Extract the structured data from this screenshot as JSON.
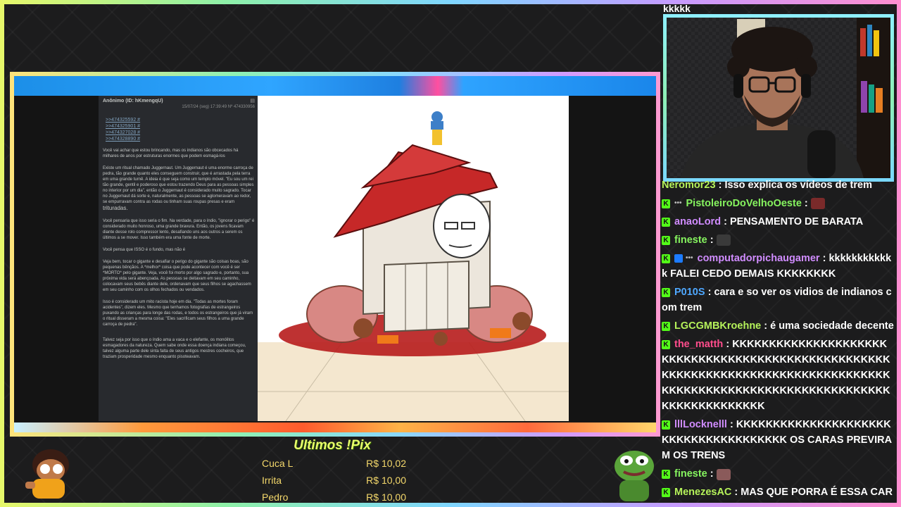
{
  "post": {
    "author": "Anônimo (ID: hKmengqU)",
    "datetime": "15/07/24 (seg) 17:39:49 Nº 474330956",
    "links": [
      ">>474325592 #",
      ">>474325901 #",
      ">>474327028 #",
      ">>474328890 #"
    ],
    "paragraphs": [
      "Você vai achar que estou brincando, mas os indianos são obcecados há milhares de anos por estruturas enormes que podem esmagá-los",
      "Existe um ritual chamado Juggernaut. Um Juggernaut é uma enorme carroça de pedra, tão grande quanto eles conseguem construir, que é arrastada pela terra em uma grande turnê. A ideia é que seja como um templo móvel. \"Eu sou um rei tão grande, gentil e poderoso que estou trazendo Deus para as pessoas simples no interior por um dia\", então o Juggernaut é considerado muito sagrado. Tocar no Juggernaut dá sorte e, naturalmente, as pessoas se aglomeravam ao redor, se empurravam contra as rodas ou tinham suas roupas presas e eram",
      "Você pensaria que isso seria o fim. Na verdade, para o índio, \"ignorar o perigo\" é considerado muito honroso, uma grande bravura. Então, os jovens ficavam diante desse rolo compressor lento, desafiando uns aos outros a serem os últimos a se mover. Isso também era uma fonte de morte.",
      "Você pensa que ISSO é o fundo, mas não é",
      "Veja bem, tocar o gigante e desafiar o perigo do gigante são coisas boas, são pequenas bênçãos. A *melhor* coisa que pode acontecer com você é ser *MORTO* pelo gigante. Veja, você foi morto por algo sagrado e, portanto, sua próxima vida será abençoada. As pessoas se deitavam em seu caminho, colocavam seus bebês diante dele, ordenavam que seus filhos se agachassem em seu caminho com os olhos fechados ou vendados.",
      "Isso é considerado um mito racista hoje em dia. \"Todas as mortes foram acidentes\", dizem eles. Mesmo que tenhamos fotografias de estrangeiros puxando as crianças para longe das rodas, e todos os estrangeiros que já viram o ritual disseram a mesma coisa: \"Eles sacrificam seus filhos a uma grande carroça de pedra\".",
      "Talvez seja por isso que o índio ama a vaca e o elefante, os monólitos esmagadores da natureza. Quem sabe onde essa doença indiana começou, talvez alguma parte dele sinta falta de seus antigos mestres cocheiros, que traziam prosperidade mesmo enquanto pisoteavam."
    ],
    "big_word": "trituradas."
  },
  "chat": {
    "top_line": "kkkkk",
    "messages": [
      {
        "user": "Neromor23",
        "text": "Isso explica os vídeos de trem",
        "color": "#b5f25a"
      },
      {
        "user": "PistoleiroDoVelhoOeste",
        "text": "",
        "color": "#86f45f",
        "emote": true
      },
      {
        "user": "anaoLord",
        "text": "PENSAMENTO DE BARATA",
        "color": "#d08cff"
      },
      {
        "user": "fineste",
        "text": "",
        "color": "#86f45f",
        "emote": true
      },
      {
        "user": "computadorpichaugamer",
        "text": "kkkkkkkkkkkk FALEI CEDO DEMAIS KKKKKKKK",
        "color": "#d08cff"
      },
      {
        "user": "P010S",
        "text": "cara e so ver os vidios de indianos com trem",
        "color": "#4fa8ff"
      },
      {
        "user": "LGCGMBKroehne",
        "text": "é uma sociedade decente",
        "color": "#b5f25a"
      },
      {
        "user": "the_matth",
        "text": "KKKKKKKKKKKKKKKKKKKKKKKKKKKKKKKKKKKKKKKKKKKKKKKKKKKKKKKKKKKKKKKKKKKKKKKKKKKKKKKKKKKKKKKKKKKKKKKKKKKKKKKKKKKKKKKKKKKKKKKKKKKKKKKK",
        "color": "#ff4d8c"
      },
      {
        "user": "lllLocknelll",
        "text": "KKKKKKKKKKKKKKKKKKKKKKKKKKKKKKKKKKKKKK OS CARAS PREVIRAM OS TRENS",
        "color": "#d08cff"
      },
      {
        "user": "fineste",
        "text": "",
        "color": "#86f45f",
        "emote": true
      },
      {
        "user": "MenezesAC",
        "text": "MAS QUE PORRA É ESSA CARA",
        "color": "#b5f25a"
      }
    ]
  },
  "pix": {
    "title": "Ultimos !Pix",
    "rows": [
      {
        "name": "Cuca L",
        "amount": "R$ 10,02"
      },
      {
        "name": "Irrita",
        "amount": "R$ 10,00"
      },
      {
        "name": "Pedro",
        "amount": "R$ 10,00"
      }
    ]
  },
  "colors": {
    "chat_badge": "#53fc18",
    "pix_title": "#e9ff6b",
    "pix_text": "#f4d86b"
  }
}
